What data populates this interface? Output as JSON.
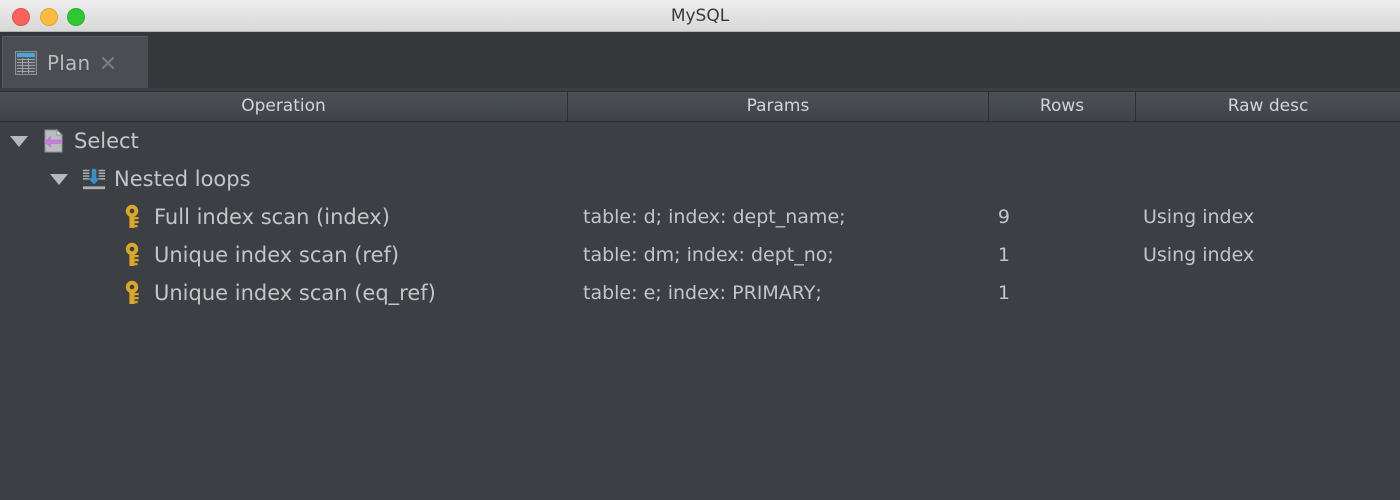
{
  "window": {
    "title": "MySQL",
    "controls": [
      {
        "name": "close",
        "color": "#f9635c"
      },
      {
        "name": "minimize",
        "color": "#fcbc40"
      },
      {
        "name": "maximize",
        "color": "#2fc732"
      }
    ]
  },
  "tabs": [
    {
      "label": "Plan",
      "icon": "table-icon",
      "active": true,
      "closable": true
    }
  ],
  "table": {
    "columns": [
      {
        "key": "operation",
        "label": "Operation"
      },
      {
        "key": "params",
        "label": "Params"
      },
      {
        "key": "rows",
        "label": "Rows"
      },
      {
        "key": "raw_desc",
        "label": "Raw desc"
      }
    ],
    "rows": [
      {
        "operation": "Select",
        "icon": "select-document-icon",
        "depth": 0,
        "expanded": true,
        "has_children": true,
        "params": "",
        "rows": "",
        "raw_desc": ""
      },
      {
        "operation": "Nested loops",
        "icon": "nested-loops-icon",
        "depth": 1,
        "expanded": true,
        "has_children": true,
        "params": "",
        "rows": "",
        "raw_desc": ""
      },
      {
        "operation": "Full index scan (index)",
        "icon": "key-icon",
        "depth": 2,
        "expanded": false,
        "has_children": false,
        "params": "table: d; index: dept_name;",
        "rows": "9",
        "raw_desc": "Using index"
      },
      {
        "operation": "Unique index scan (ref)",
        "icon": "key-icon",
        "depth": 2,
        "expanded": false,
        "has_children": false,
        "params": "table: dm; index: dept_no;",
        "rows": "1",
        "raw_desc": "Using index"
      },
      {
        "operation": "Unique index scan (eq_ref)",
        "icon": "key-icon",
        "depth": 2,
        "expanded": false,
        "has_children": false,
        "params": "table: e; index: PRIMARY;",
        "rows": "1",
        "raw_desc": ""
      }
    ]
  },
  "colors": {
    "background": "#3c4044",
    "header_bar": "#454a4e",
    "tab_active": "#4a4e52",
    "text": "#c3c6c8",
    "key_icon": "#d9a82a",
    "arrow_blue": "#3b8fc4",
    "arrow_purple": "#c17fd6"
  }
}
